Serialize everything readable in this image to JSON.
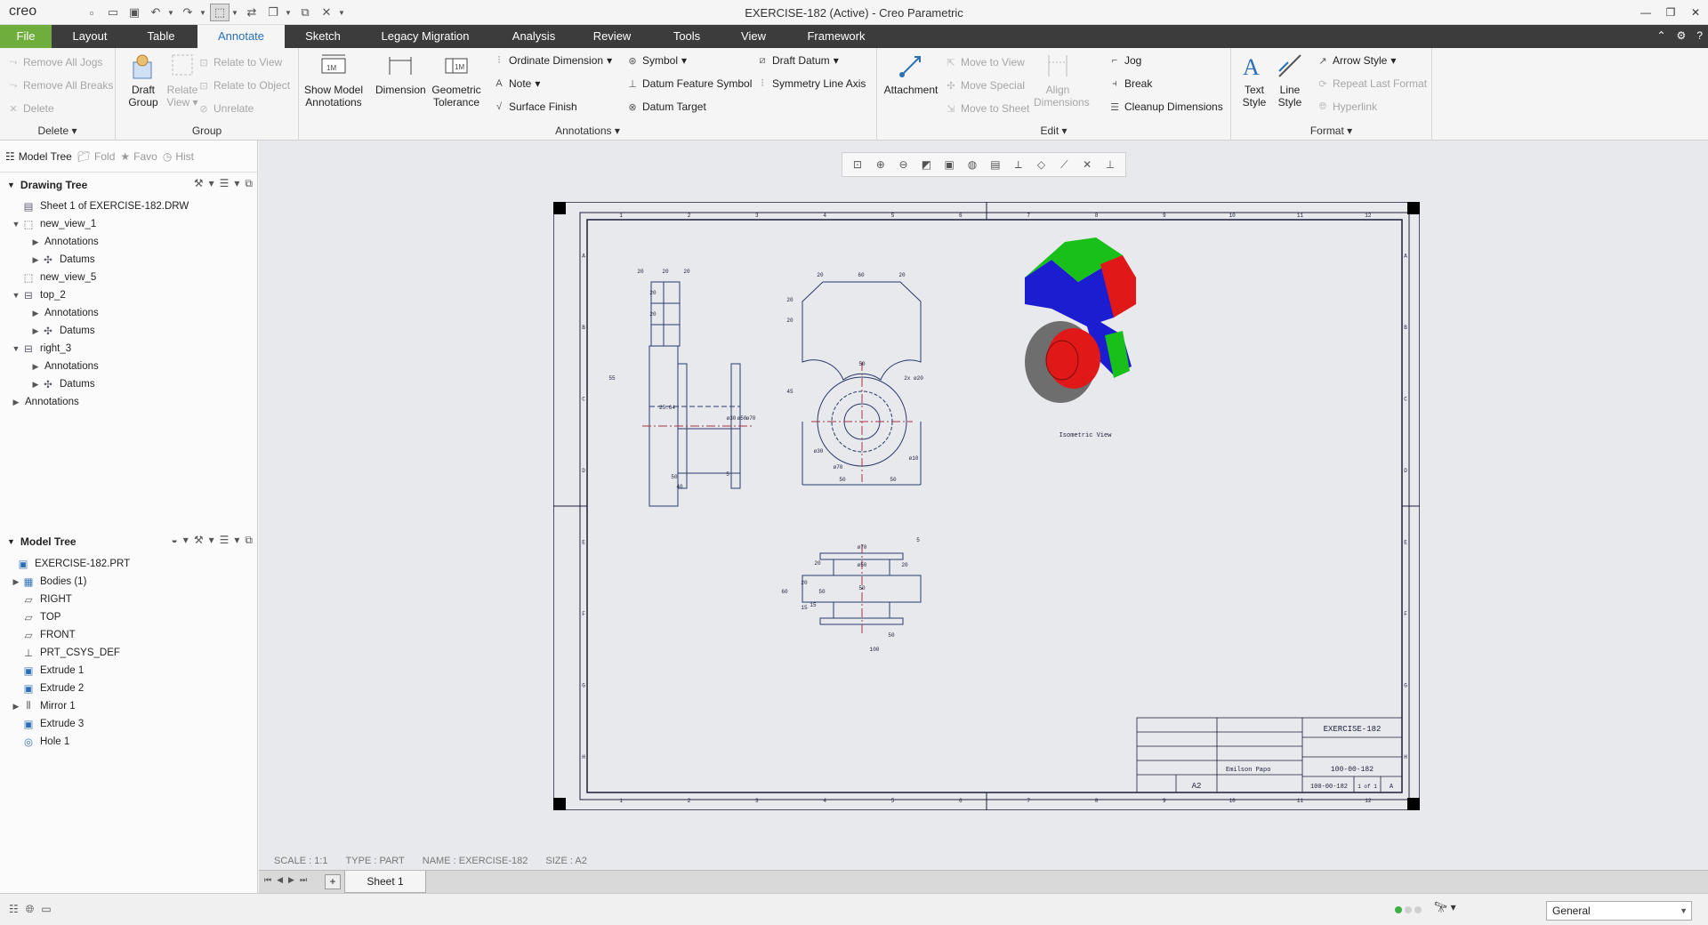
{
  "app": {
    "logo": "creo",
    "window_title": "EXERCISE-182 (Active) - Creo Parametric"
  },
  "tabs": [
    "File",
    "Layout",
    "Table",
    "Annotate",
    "Sketch",
    "Legacy Migration",
    "Analysis",
    "Review",
    "Tools",
    "View",
    "Framework"
  ],
  "ribbon": {
    "delete_group": {
      "label": "Delete",
      "items": [
        "Remove All Jogs",
        "Remove All Breaks",
        "Delete"
      ]
    },
    "group_group": {
      "label": "Group",
      "draft_group": "Draft Group",
      "relate_view": "Relate View",
      "relate_to_view": "Relate to View",
      "relate_to_object": "Relate to Object",
      "unrelate": "Unrelate"
    },
    "show_model_annotations": "Show Model Annotations",
    "dimension": "Dimension",
    "geometric_tolerance": "Geometric Tolerance",
    "annotations_group": {
      "label": "Annotations",
      "ordinate_dimension": "Ordinate Dimension",
      "note": "Note",
      "surface_finish": "Surface Finish",
      "symbol": "Symbol",
      "datum_feature_symbol": "Datum Feature Symbol",
      "datum_target": "Datum Target",
      "draft_datum": "Draft Datum",
      "symmetry_line_axis": "Symmetry Line Axis"
    },
    "edit_group": {
      "label": "Edit",
      "attachment": "Attachment",
      "move_to_view": "Move to View",
      "move_special": "Move Special",
      "move_to_sheet": "Move to Sheet",
      "align_dimensions": "Align Dimensions",
      "jog": "Jog",
      "break": "Break",
      "cleanup_dimensions": "Cleanup Dimensions"
    },
    "format_group": {
      "label": "Format",
      "text_style": "Text Style",
      "line_style": "Line Style",
      "arrow_style": "Arrow Style",
      "repeat_last_format": "Repeat Last Format",
      "hyperlink": "Hyperlink"
    }
  },
  "panel_tabs": [
    "Model Tree",
    "Fold",
    "Favo",
    "Hist"
  ],
  "drawing_tree": {
    "title": "Drawing Tree",
    "items": [
      {
        "label": "Sheet 1 of EXERCISE-182.DRW"
      },
      {
        "label": "new_view_1"
      },
      {
        "label": "Annotations"
      },
      {
        "label": "Datums"
      },
      {
        "label": "new_view_5"
      },
      {
        "label": "top_2"
      },
      {
        "label": "Annotations"
      },
      {
        "label": "Datums"
      },
      {
        "label": "right_3"
      },
      {
        "label": "Annotations"
      },
      {
        "label": "Datums"
      },
      {
        "label": "Annotations"
      }
    ]
  },
  "model_tree": {
    "title": "Model Tree",
    "items": [
      {
        "label": "EXERCISE-182.PRT"
      },
      {
        "label": "Bodies (1)"
      },
      {
        "label": "RIGHT"
      },
      {
        "label": "TOP"
      },
      {
        "label": "FRONT"
      },
      {
        "label": "PRT_CSYS_DEF"
      },
      {
        "label": "Extrude 1"
      },
      {
        "label": "Extrude 2"
      },
      {
        "label": "Mirror 1"
      },
      {
        "label": "Extrude 3"
      },
      {
        "label": "Hole 1"
      }
    ]
  },
  "drawing": {
    "isometric_label": "Isometric View",
    "title_block": {
      "part_name": "EXERCISE-182",
      "drawing_no": "100-00-182",
      "size": "A2",
      "author": "Emilson Papo",
      "sheet": "1 of 1",
      "rev": "A"
    },
    "side_dims": [
      "20",
      "20",
      "20",
      "20",
      "20",
      "55",
      "25.64",
      "ø30",
      "ø50",
      "ø70",
      "50",
      "5",
      "40"
    ],
    "front_dims": [
      "20",
      "60",
      "20",
      "20",
      "20",
      "50",
      "45",
      "2x ø20",
      "ø30",
      "ø70",
      "ø10",
      "50",
      "50"
    ],
    "top_dims": [
      "ø70",
      "5",
      "20",
      "ø50",
      "20",
      "60",
      "50",
      "15",
      "20",
      "15",
      "50",
      "100",
      "50"
    ],
    "border_cols": [
      "1",
      "2",
      "3",
      "4",
      "5",
      "6",
      "7",
      "8",
      "9",
      "10",
      "11",
      "12"
    ],
    "border_rows": [
      "A",
      "B",
      "C",
      "D",
      "E",
      "F",
      "G",
      "H"
    ]
  },
  "sheet_info": {
    "scale": "SCALE : 1:1",
    "type": "TYPE : PART",
    "name": "NAME : EXERCISE-182",
    "size": "SIZE : A2"
  },
  "sheet_tab": "Sheet 1",
  "status": {
    "filter": "General"
  },
  "colors": {
    "file_tab": "#6fae3c",
    "active_tab_text": "#2b6fb6",
    "dim_line": "#2a3a6b",
    "model_blue": "#1c1cd0",
    "model_red": "#e01818",
    "model_green": "#19c019",
    "model_gray": "#6e6e6e"
  }
}
